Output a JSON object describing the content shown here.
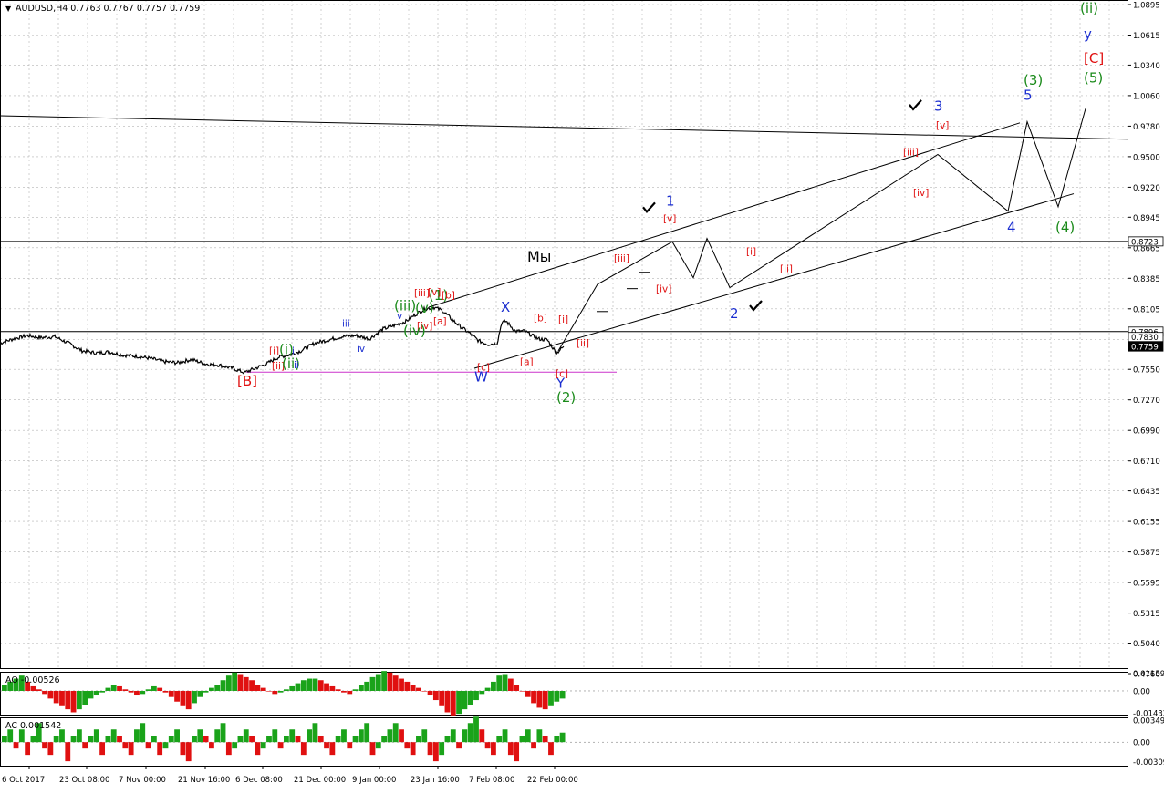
{
  "symbol_info": {
    "symbol": "AUDUSD,H4",
    "open": "0.7763",
    "high": "0.7767",
    "low": "0.7757",
    "close": "0.7759"
  },
  "colors": {
    "price": "#000000",
    "grid": "#b4b4b4",
    "green_label": "#1a8a1a",
    "blue_label": "#1c2fd0",
    "red_label": "#e01010",
    "magenta_line": "#cc33cc",
    "ao_up": "#1aa31a",
    "ao_down": "#e01010"
  },
  "chart_data": [
    {
      "type": "line",
      "name": "price",
      "title": "AUDUSD,H4 0.7763 0.7767 0.7757 0.7759",
      "y_ticks": [
        "1.0895",
        "1.0615",
        "1.0340",
        "1.0060",
        "0.9780",
        "0.9500",
        "0.9220",
        "0.8945",
        "0.8665",
        "0.8385",
        "0.8105",
        "0.7825",
        "0.7550",
        "0.7270",
        "0.6990",
        "0.6710",
        "0.6435",
        "0.6155",
        "0.5875",
        "0.5595",
        "0.5315",
        "0.5040",
        "0.4760"
      ],
      "ylim": [
        0.476,
        1.0895
      ],
      "grid": true,
      "x_ticks": [
        "6 Oct 2017",
        "23 Oct 08:00",
        "7 Nov 00:00",
        "21 Nov 16:00",
        "6 Dec 08:00",
        "21 Dec 00:00",
        "9 Jan 00:00",
        "23 Jan 16:00",
        "7 Feb 08:00",
        "22 Feb 00:00"
      ],
      "price_anchors": [
        [
          0,
          0.779
        ],
        [
          15,
          0.783
        ],
        [
          30,
          0.786
        ],
        [
          45,
          0.784
        ],
        [
          60,
          0.785
        ],
        [
          75,
          0.779
        ],
        [
          90,
          0.772
        ],
        [
          105,
          0.77
        ],
        [
          120,
          0.771
        ],
        [
          135,
          0.768
        ],
        [
          150,
          0.767
        ],
        [
          165,
          0.765
        ],
        [
          180,
          0.762
        ],
        [
          195,
          0.761
        ],
        [
          210,
          0.764
        ],
        [
          225,
          0.76
        ],
        [
          240,
          0.759
        ],
        [
          255,
          0.756
        ],
        [
          268,
          0.752
        ],
        [
          280,
          0.756
        ],
        [
          292,
          0.76
        ],
        [
          305,
          0.766
        ],
        [
          320,
          0.769
        ],
        [
          330,
          0.772
        ],
        [
          345,
          0.779
        ],
        [
          360,
          0.782
        ],
        [
          375,
          0.785
        ],
        [
          390,
          0.786
        ],
        [
          405,
          0.783
        ],
        [
          420,
          0.792
        ],
        [
          435,
          0.796
        ],
        [
          445,
          0.799
        ],
        [
          455,
          0.805
        ],
        [
          465,
          0.81
        ],
        [
          475,
          0.812
        ],
        [
          485,
          0.809
        ],
        [
          495,
          0.801
        ],
        [
          505,
          0.794
        ],
        [
          515,
          0.788
        ],
        [
          525,
          0.781
        ],
        [
          535,
          0.778
        ],
        [
          545,
          0.779
        ],
        [
          550,
          0.798
        ],
        [
          555,
          0.799
        ],
        [
          565,
          0.79
        ],
        [
          575,
          0.79
        ],
        [
          590,
          0.783
        ],
        [
          600,
          0.782
        ],
        [
          610,
          0.77
        ],
        [
          618,
          0.7759
        ]
      ],
      "current_price": "0.7759",
      "price_labels": [
        "0.8723",
        "0.7896",
        "0.7830",
        "0.7759"
      ]
    },
    {
      "type": "bar",
      "name": "AO",
      "title": "AO -0.00526",
      "y_ticks": [
        "0.01159",
        "0.00",
        "-0.01432"
      ],
      "ylim": [
        -0.0155,
        0.0125
      ],
      "values": [
        0.004,
        0.006,
        0.008,
        0.01,
        0.006,
        0.003,
        0.001,
        -0.002,
        -0.005,
        -0.008,
        -0.01,
        -0.012,
        -0.014,
        -0.012,
        -0.009,
        -0.005,
        -0.003,
        -0.001,
        0.002,
        0.004,
        0.003,
        0.001,
        -0.001,
        -0.003,
        -0.002,
        0.001,
        0.003,
        0.002,
        -0.001,
        -0.004,
        -0.007,
        -0.01,
        -0.012,
        -0.008,
        -0.004,
        -0.001,
        0.002,
        0.004,
        0.007,
        0.01,
        0.012,
        0.011,
        0.009,
        0.007,
        0.004,
        0.002,
        0.0,
        -0.002,
        -0.001,
        0.001,
        0.003,
        0.005,
        0.007,
        0.008,
        0.008,
        0.007,
        0.005,
        0.003,
        0.001,
        -0.001,
        -0.002,
        0.001,
        0.004,
        0.006,
        0.009,
        0.011,
        0.013,
        0.012,
        0.01,
        0.008,
        0.006,
        0.004,
        0.002,
        0.0,
        -0.003,
        -0.006,
        -0.01,
        -0.014,
        -0.016,
        -0.015,
        -0.012,
        -0.009,
        -0.006,
        -0.002,
        0.002,
        0.006,
        0.01,
        0.011,
        0.008,
        0.004,
        0.0,
        -0.004,
        -0.008,
        -0.011,
        -0.012,
        -0.01,
        -0.007,
        -0.005
      ]
    },
    {
      "type": "bar",
      "name": "AC",
      "title": "AC 0.001542",
      "y_ticks": [
        "0.003491",
        "0.00",
        "-0.00309"
      ],
      "ylim": [
        -0.0037,
        0.0039
      ],
      "values": [
        0.001,
        0.002,
        -0.001,
        0.002,
        -0.002,
        0.001,
        0.003,
        -0.001,
        -0.002,
        0.001,
        0.002,
        -0.003,
        0.001,
        0.002,
        -0.001,
        0.001,
        0.002,
        -0.002,
        0.001,
        0.002,
        0.001,
        -0.001,
        -0.002,
        0.002,
        0.003,
        -0.001,
        0.001,
        -0.002,
        -0.001,
        0.001,
        0.002,
        -0.002,
        -0.003,
        0.001,
        0.002,
        0.001,
        -0.001,
        0.002,
        0.003,
        -0.002,
        -0.001,
        0.001,
        0.002,
        0.001,
        -0.002,
        -0.001,
        0.001,
        0.002,
        -0.001,
        0.001,
        0.002,
        0.001,
        -0.002,
        0.002,
        0.003,
        0.001,
        -0.001,
        -0.002,
        0.001,
        0.002,
        -0.001,
        0.001,
        0.002,
        0.003,
        -0.002,
        -0.001,
        0.001,
        0.002,
        0.003,
        0.002,
        -0.001,
        -0.002,
        0.001,
        0.002,
        -0.002,
        -0.003,
        -0.002,
        0.001,
        0.002,
        -0.001,
        0.002,
        0.003,
        0.004,
        0.002,
        -0.001,
        -0.002,
        0.001,
        0.002,
        -0.002,
        -0.003,
        0.001,
        0.002,
        -0.001,
        0.002,
        0.001,
        -0.002,
        0.001,
        0.0015
      ]
    }
  ],
  "wave_labels": [
    {
      "text": "(1)",
      "color": "green",
      "x": 470,
      "y": 0.8185
    },
    {
      "text": "(2)",
      "color": "green",
      "x": 610,
      "y": 0.725
    },
    {
      "text": "(3)",
      "color": "green",
      "x": 1122,
      "y": 1.016
    },
    {
      "text": "(4)",
      "color": "green",
      "x": 1157,
      "y": 0.881
    },
    {
      "text": "(5)",
      "color": "green",
      "x": 1188,
      "y": 1.018
    },
    {
      "text": "(ii)",
      "color": "green",
      "x": 1184,
      "y": 1.082
    },
    {
      "text": "y",
      "color": "blue",
      "x": 1188,
      "y": 1.058
    },
    {
      "text": "[C]",
      "color": "red",
      "x": 1188,
      "y": 1.036
    },
    {
      "text": "3",
      "color": "blue",
      "x": 1024,
      "y": 0.992
    },
    {
      "text": "5",
      "color": "blue",
      "x": 1122,
      "y": 1.002
    },
    {
      "text": "4",
      "color": "blue",
      "x": 1104,
      "y": 0.881
    },
    {
      "text": "1",
      "color": "blue",
      "x": 730,
      "y": 0.905
    },
    {
      "text": "2",
      "color": "blue",
      "x": 800,
      "y": 0.802
    },
    {
      "text": "X",
      "color": "blue",
      "x": 549,
      "y": 0.808
    },
    {
      "text": "W",
      "color": "blue",
      "x": 520,
      "y": 0.744
    },
    {
      "text": "Y",
      "color": "blue",
      "x": 610,
      "y": 0.738
    },
    {
      "text": "[B]",
      "color": "red",
      "x": 260,
      "y": 0.74
    },
    {
      "text": "[v]",
      "color": "red",
      "x": 1026,
      "y": 0.976
    },
    {
      "text": "[iii]",
      "color": "red",
      "x": 990,
      "y": 0.951
    },
    {
      "text": "[iv]",
      "color": "red",
      "x": 1001,
      "y": 0.914
    },
    {
      "text": "[i]",
      "color": "red",
      "x": 818,
      "y": 0.86
    },
    {
      "text": "[ii]",
      "color": "red",
      "x": 855,
      "y": 0.844
    },
    {
      "text": "[v]",
      "color": "red",
      "x": 727,
      "y": 0.89
    },
    {
      "text": "[iii]",
      "color": "red",
      "x": 673,
      "y": 0.854
    },
    {
      "text": "[iv]",
      "color": "red",
      "x": 719,
      "y": 0.826
    },
    {
      "text": "[i]",
      "color": "red",
      "x": 612,
      "y": 0.798
    },
    {
      "text": "[ii]",
      "color": "red",
      "x": 632,
      "y": 0.776
    },
    {
      "text": "[b]",
      "color": "red",
      "x": 585,
      "y": 0.799
    },
    {
      "text": "[a]",
      "color": "red",
      "x": 570,
      "y": 0.759
    },
    {
      "text": "[c]",
      "color": "red",
      "x": 523,
      "y": 0.754
    },
    {
      "text": "[c]",
      "color": "red",
      "x": 609,
      "y": 0.748
    },
    {
      "text": "[b]",
      "color": "red",
      "x": 484,
      "y": 0.82
    },
    {
      "text": "[a]",
      "color": "red",
      "x": 475,
      "y": 0.796
    },
    {
      "text": "[iii]",
      "color": "red",
      "x": 454,
      "y": 0.822
    },
    {
      "text": "[v]",
      "color": "red",
      "x": 469,
      "y": 0.823
    },
    {
      "text": "[iv]",
      "color": "red",
      "x": 457,
      "y": 0.792
    },
    {
      "text": "[i]",
      "color": "red",
      "x": 295,
      "y": 0.769
    },
    {
      "text": "[ii]",
      "color": "red",
      "x": 298,
      "y": 0.755
    },
    {
      "text": "(i)",
      "color": "green",
      "x": 306,
      "y": 0.769
    },
    {
      "text": "(ii)",
      "color": "green",
      "x": 309,
      "y": 0.756
    },
    {
      "text": "i",
      "color": "blue",
      "x": 320,
      "y": 0.769
    },
    {
      "text": "ii",
      "color": "blue",
      "x": 322,
      "y": 0.756
    },
    {
      "text": "iii",
      "color": "blue",
      "x": 375,
      "y": 0.794
    },
    {
      "text": "iv",
      "color": "blue",
      "x": 391,
      "y": 0.771
    },
    {
      "text": "(iii)",
      "color": "green",
      "x": 432,
      "y": 0.809
    },
    {
      "text": "(v)",
      "color": "green",
      "x": 455,
      "y": 0.807
    },
    {
      "text": "v",
      "color": "blue",
      "x": 435,
      "y": 0.801
    },
    {
      "text": "(iv)",
      "color": "green",
      "x": 442,
      "y": 0.786
    },
    {
      "text": "Мы",
      "color": "black",
      "x": 578,
      "y": 0.854
    }
  ],
  "checkmarks": [
    {
      "x": 997,
      "y": 0.996
    },
    {
      "x": 705,
      "y": 0.902
    },
    {
      "x": 822,
      "y": 0.812
    }
  ],
  "projection_path": [
    [
      612,
      0.772
    ],
    [
      655,
      0.833
    ],
    [
      737,
      0.872
    ],
    [
      760,
      0.839
    ],
    [
      775,
      0.875
    ],
    [
      800,
      0.83
    ],
    [
      1028,
      0.952
    ],
    [
      1105,
      0.9
    ],
    [
      1126,
      0.982
    ],
    [
      1160,
      0.904
    ],
    [
      1190,
      0.994
    ]
  ],
  "trendlines": [
    {
      "from": [
        470,
        0.812
      ],
      "to": [
        1118,
        0.981
      ],
      "color": "#000000"
    },
    {
      "from": [
        520,
        0.756
      ],
      "to": [
        1177,
        0.916
      ],
      "color": "#000000"
    },
    {
      "from": [
        0,
        0.9875
      ],
      "to": [
        1236,
        0.966
      ],
      "color": "#000000"
    },
    {
      "from": [
        270,
        0.7525
      ],
      "to": [
        676,
        0.7525
      ],
      "color": "#cc33cc"
    }
  ],
  "horizontal_levels": [
    0.8723,
    0.7896
  ],
  "dash_marks": [
    {
      "x": 706,
      "y": 0.844
    },
    {
      "x": 693,
      "y": 0.829
    },
    {
      "x": 660,
      "y": 0.808
    }
  ]
}
